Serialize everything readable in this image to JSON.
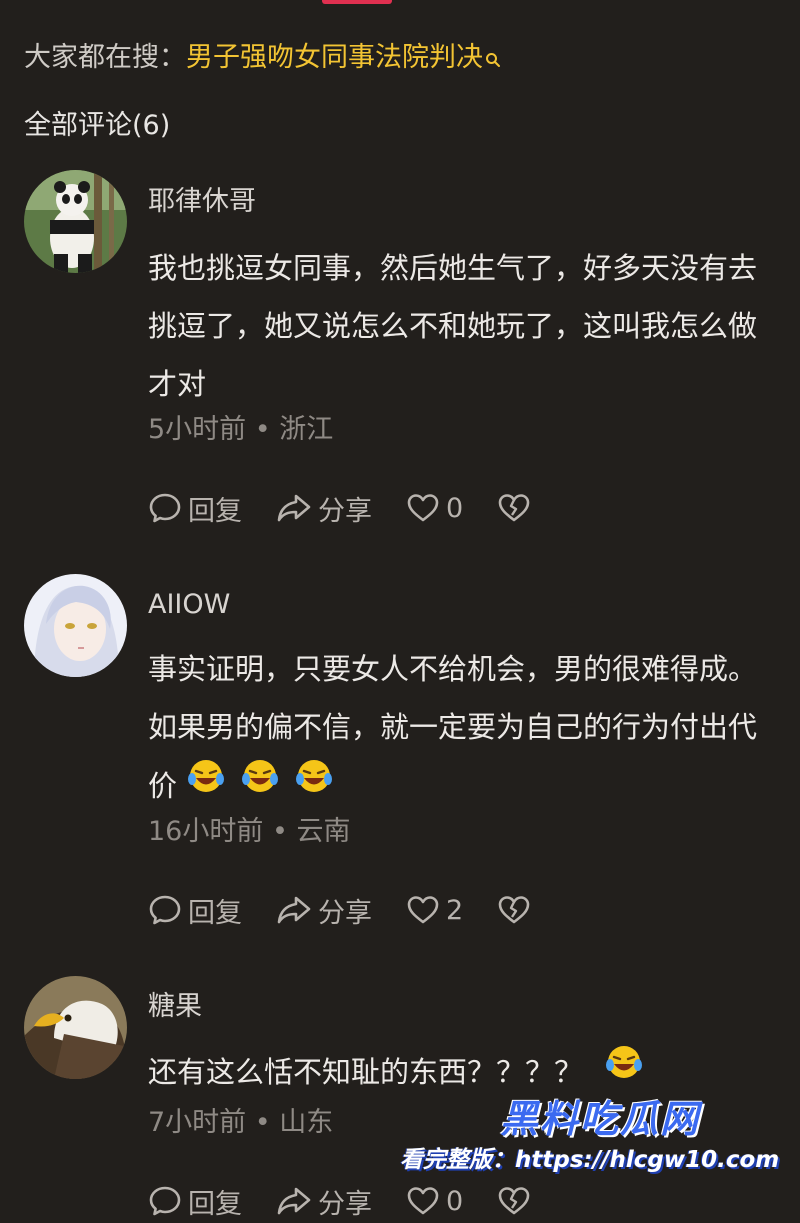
{
  "search": {
    "prefix": "大家都在搜：",
    "term": "男子强吻女同事法院判决",
    "icon": "search-icon"
  },
  "comments_header": {
    "title": "全部评论(6)"
  },
  "comments": [
    {
      "username": "耶律休哥",
      "text": "我也挑逗女同事，然后她生气了，好多天没有去挑逗了，她又说怎么不和她玩了，这叫我怎么做才对",
      "time": "5小时前",
      "location": "浙江",
      "reply_label": "回复",
      "share_label": "分享",
      "like_count": "0"
    },
    {
      "username": "AIIOW",
      "text": "事实证明，只要女人不给机会，男的很难得成。如果男的偏不信，就一定要为自己的行为付出代价",
      "emojis": 3,
      "time": "16小时前",
      "location": "云南",
      "reply_label": "回复",
      "share_label": "分享",
      "like_count": "2"
    },
    {
      "username": "糖果",
      "text": "还有这么恬不知耻的东西？？？？",
      "emojis": 1,
      "time": "7小时前",
      "location": "山东",
      "reply_label": "回复",
      "share_label": "分享",
      "like_count": "0"
    }
  ],
  "separator": " • ",
  "watermark": {
    "title": "黑料吃瓜网",
    "url": "看完整版：https://hlcgw10.com"
  },
  "colors": {
    "background": "#221f1c",
    "search_term": "#f3c433",
    "accent": "#e03050",
    "watermark_blue": "#3b6af0"
  }
}
